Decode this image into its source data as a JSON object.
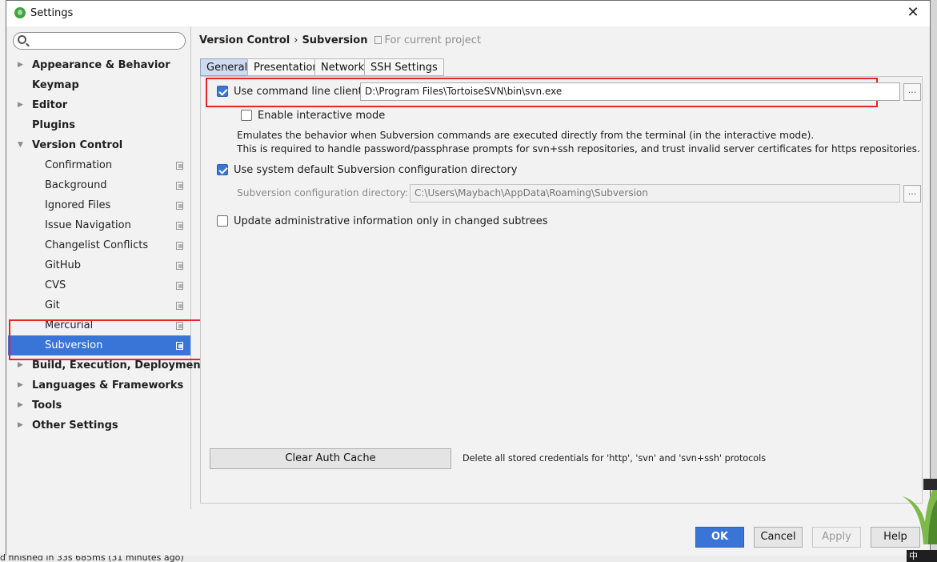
{
  "window": {
    "title": "Settings",
    "close_label": "✕"
  },
  "search": {
    "placeholder": ""
  },
  "tree": [
    {
      "label": "Appearance & Behavior",
      "level": "top",
      "arrow": "▶"
    },
    {
      "label": "Keymap",
      "level": "top",
      "arrow": ""
    },
    {
      "label": "Editor",
      "level": "top",
      "arrow": "▶"
    },
    {
      "label": "Plugins",
      "level": "top",
      "arrow": ""
    },
    {
      "label": "Version Control",
      "level": "top",
      "arrow": "▼"
    },
    {
      "label": "Confirmation",
      "level": "sub"
    },
    {
      "label": "Background",
      "level": "sub"
    },
    {
      "label": "Ignored Files",
      "level": "sub"
    },
    {
      "label": "Issue Navigation",
      "level": "sub"
    },
    {
      "label": "Changelist Conflicts",
      "level": "sub"
    },
    {
      "label": "GitHub",
      "level": "sub"
    },
    {
      "label": "CVS",
      "level": "sub"
    },
    {
      "label": "Git",
      "level": "sub"
    },
    {
      "label": "Mercurial",
      "level": "sub"
    },
    {
      "label": "Subversion",
      "level": "sub",
      "selected": true
    },
    {
      "label": "Build, Execution, Deployment",
      "level": "top",
      "arrow": "▶"
    },
    {
      "label": "Languages & Frameworks",
      "level": "top",
      "arrow": "▶"
    },
    {
      "label": "Tools",
      "level": "top",
      "arrow": "▶"
    },
    {
      "label": "Other Settings",
      "level": "top",
      "arrow": "▶"
    }
  ],
  "breadcrumb": {
    "part1": "Version Control",
    "sep": "›",
    "part2": "Subversion",
    "project": "For current project"
  },
  "tabs": [
    "General",
    "Presentation",
    "Network",
    "SSH Settings"
  ],
  "general": {
    "use_cmd_client": {
      "label": "Use command line client:",
      "checked": true,
      "value": "D:\\Program Files\\TortoiseSVN\\bin\\svn.exe"
    },
    "interactive_mode": {
      "label": "Enable interactive mode",
      "checked": false
    },
    "desc_line1": "Emulates the behavior when Subversion commands are executed directly from the terminal (in the interactive mode).",
    "desc_line2": "This is required to handle password/passphrase prompts for svn+ssh repositories, and trust invalid server certificates for https repositories.",
    "use_system_config": {
      "label": "Use system default Subversion configuration directory",
      "checked": true
    },
    "config_dir": {
      "label": "Subversion configuration directory:",
      "value": "C:\\Users\\Maybach\\AppData\\Roaming\\Subversion"
    },
    "update_admin": {
      "label": "Update administrative information only in changed subtrees",
      "checked": false
    },
    "browse_label": "...",
    "clear_cache_label": "Clear Auth Cache",
    "clear_cache_desc": "Delete all stored credentials for 'http', 'svn' and 'svn+ssh' protocols"
  },
  "buttons": {
    "ok": "OK",
    "cancel": "Cancel",
    "apply": "Apply",
    "help": "Help"
  },
  "background": {
    "status_text": "d finished in 33s 685ms (31 minutes ago)",
    "ime": "中"
  },
  "colors": {
    "selection": "#3875d7",
    "highlight_box": "#e8232a",
    "checkbox_checked": "#3a78d0"
  }
}
